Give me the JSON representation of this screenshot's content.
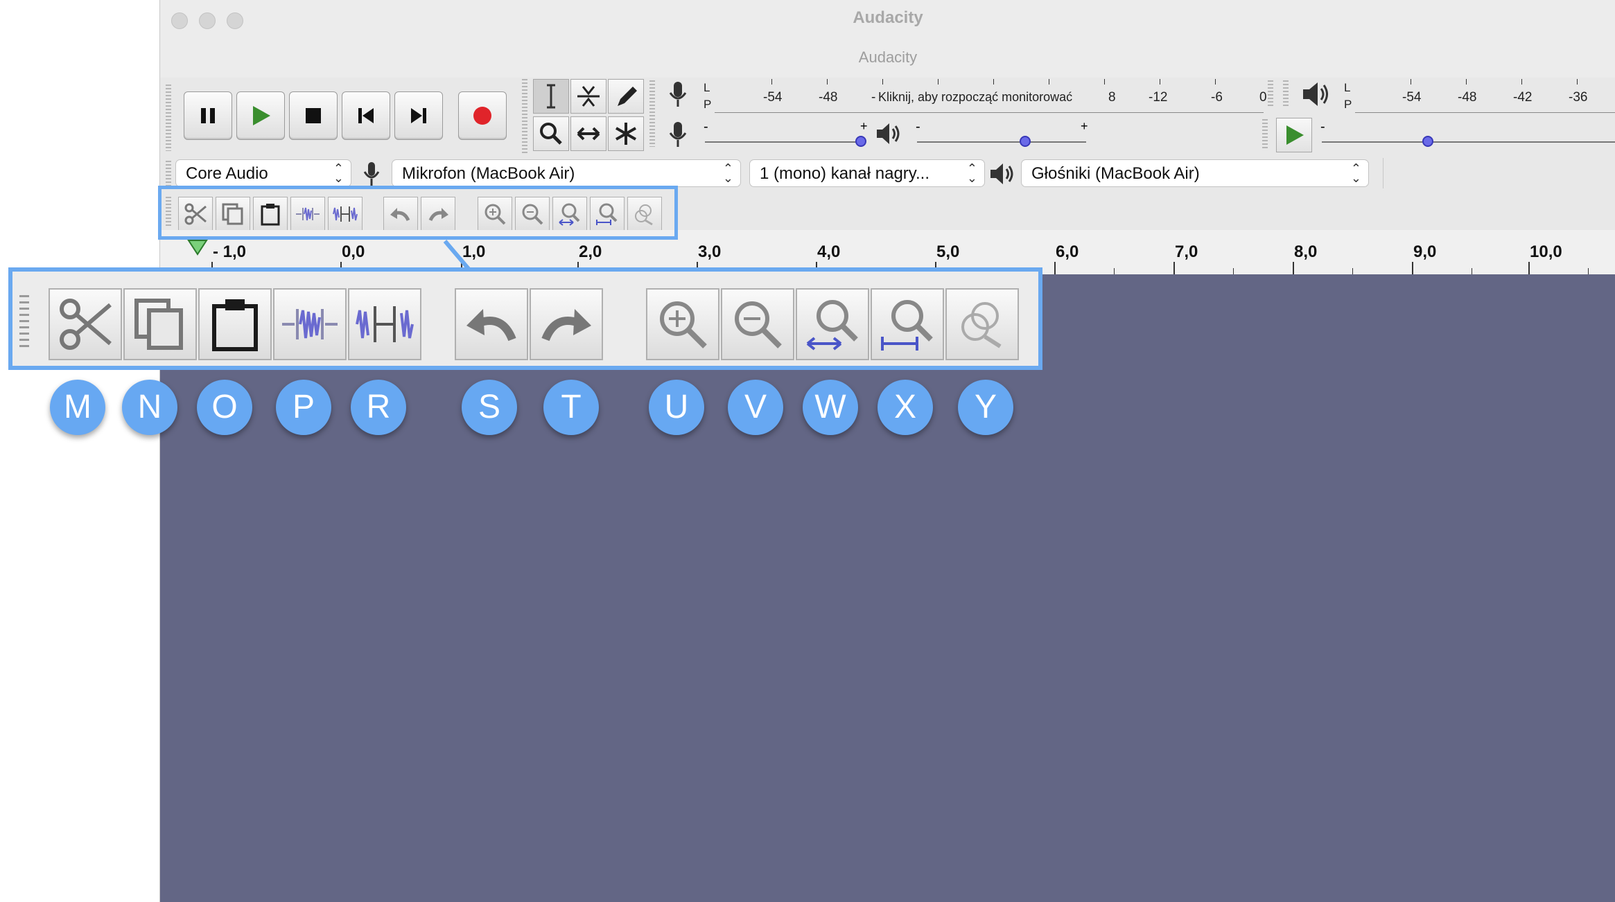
{
  "window": {
    "title": "Audacity",
    "subtitle": "Audacity"
  },
  "transport": {
    "buttons": [
      "pause-icon",
      "play-icon",
      "stop-icon",
      "skip-to-start-icon",
      "skip-to-end-icon",
      "record-icon"
    ],
    "colors": {
      "play": "#3a8e2e",
      "record": "#e0242a"
    }
  },
  "tools": [
    "selection-tool-icon",
    "envelope-tool-icon",
    "draw-tool-icon",
    "zoom-tool-icon",
    "time-shift-tool-icon",
    "multi-tool-icon"
  ],
  "recording_meter": {
    "l_label": "L",
    "p_label": "P",
    "ticks": [
      "-54",
      "-48",
      "-",
      "8",
      "-12",
      "-6",
      "0"
    ],
    "monitor_text": "Kliknij, aby rozpocząć monitorować"
  },
  "playback_meter": {
    "l_label": "L",
    "p_label": "P",
    "ticks": [
      "-54",
      "-48",
      "-42",
      "-36"
    ]
  },
  "sliders": {
    "minus": "-",
    "plus": "+",
    "rec_volume": 0.97,
    "play_volume": 0.64,
    "play_speed": 0.36
  },
  "devices": {
    "host": "Core Audio",
    "recording_device": "Mikrofon (MacBook Air)",
    "channels": "1 (mono) kanał nagry...",
    "playback_device": "Głośniki (MacBook Air)"
  },
  "edit_toolbar": {
    "buttons": [
      "cut-icon",
      "copy-icon",
      "paste-icon",
      "trim-audio-icon",
      "silence-audio-icon",
      "undo-icon",
      "redo-icon",
      "zoom-in-icon",
      "zoom-out-icon",
      "fit-selection-icon",
      "fit-project-icon",
      "zoom-toggle-icon"
    ]
  },
  "ruler": {
    "labels": [
      "- 1,0",
      "0,0",
      "1,0",
      "2,0",
      "3,0",
      "4,0",
      "5,0",
      "6,0",
      "7,0",
      "8,0",
      "9,0",
      "10,0"
    ]
  },
  "callouts": [
    "M",
    "N",
    "O",
    "P",
    "R",
    "S",
    "T",
    "U",
    "V",
    "W",
    "X",
    "Y"
  ],
  "colors": {
    "highlight": "#6aa9f0",
    "badge": "#67a8f2",
    "track_bg": "#636685",
    "zoom_accent": "#4a55c8"
  }
}
